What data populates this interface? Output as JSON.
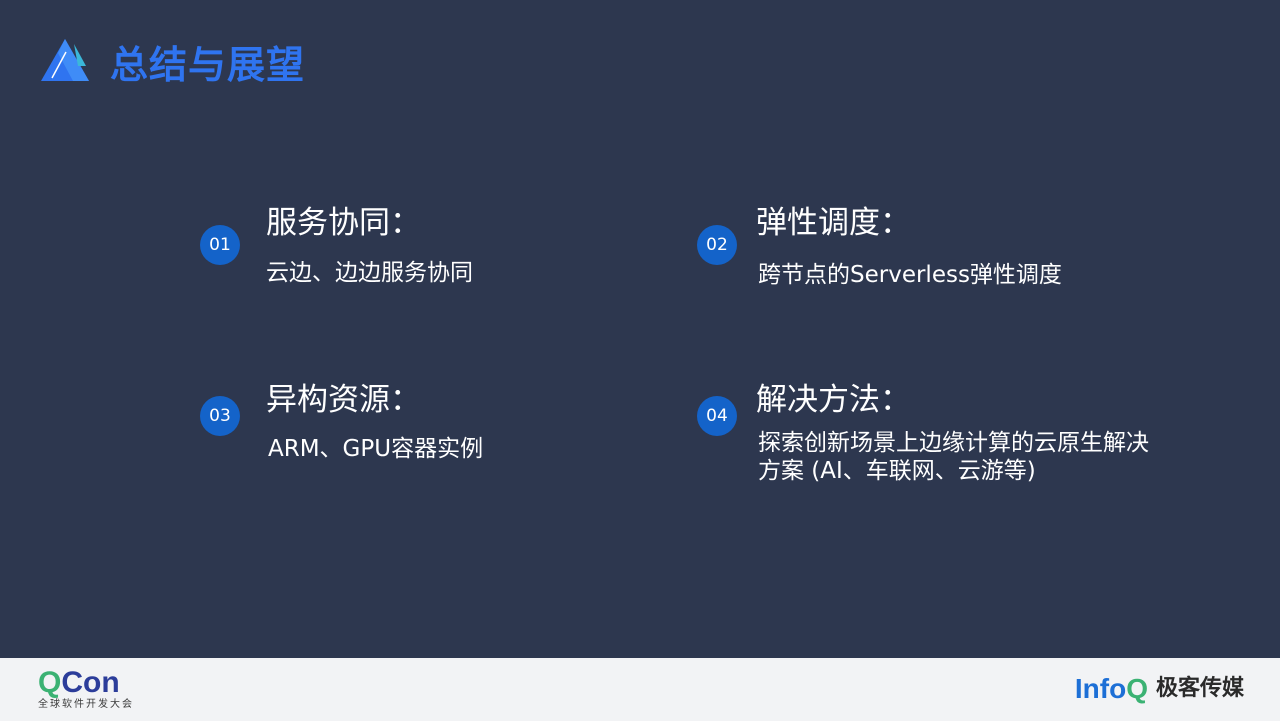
{
  "slide": {
    "title": "总结与展望"
  },
  "items": [
    {
      "number": "01",
      "heading": "服务协同：",
      "desc_lines": [
        "云边、边边服务协同"
      ]
    },
    {
      "number": "02",
      "heading": "弹性调度：",
      "desc_lines": [
        "跨节点的Serverless弹性调度"
      ]
    },
    {
      "number": "03",
      "heading": "异构资源：",
      "desc_lines": [
        "ARM、GPU容器实例"
      ]
    },
    {
      "number": "04",
      "heading": "解决方法：",
      "desc_lines": [
        "探索创新场景上边缘计算的云原生解决",
        "方案 (AI、车联网、云游等)"
      ]
    }
  ],
  "footer": {
    "qcon_q": "Q",
    "qcon_rest": "Con",
    "qcon_subtitle": "全球软件开发大会",
    "infoq_text": "Info",
    "infoq_q": "Q",
    "infoq_cn": "极客传媒"
  },
  "colors": {
    "background": "#2d374f",
    "title": "#2f74f0",
    "badge": "#1463c9",
    "footer": "#f2f3f5"
  },
  "icons": {
    "logo_mark": "triangle-logo-icon"
  }
}
